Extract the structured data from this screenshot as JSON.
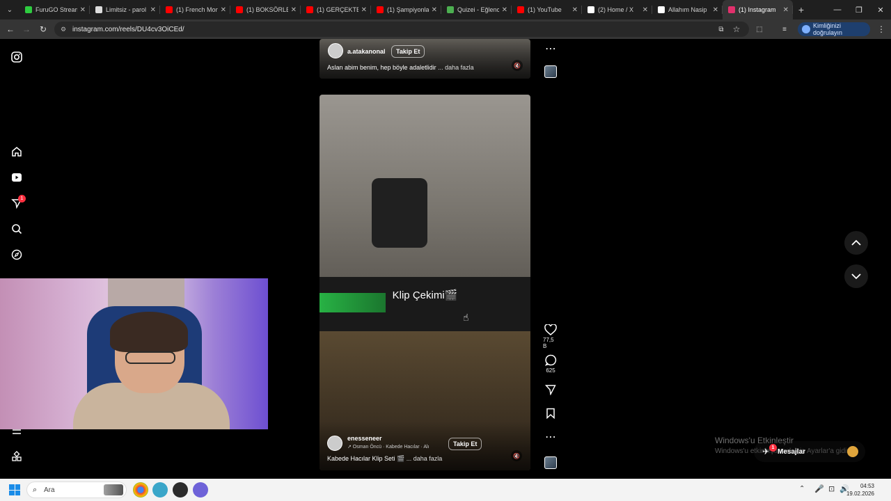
{
  "browser": {
    "tabs": [
      {
        "label": "FuruGO Stream",
        "color": "#2ecc40"
      },
      {
        "label": "Limitsiz - parol",
        "color": "#dddddd"
      },
      {
        "label": "(1) French Mon",
        "color": "#ff0000"
      },
      {
        "label": "(1) BOKSÖRLER",
        "color": "#ff0000"
      },
      {
        "label": "(1) GERÇEKTEN",
        "color": "#ff0000"
      },
      {
        "label": "(1) Şampiyonla",
        "color": "#ff0000"
      },
      {
        "label": "Quizei - Eğlenc",
        "color": "#4caf50"
      },
      {
        "label": "(1) YouTube",
        "color": "#ff0000"
      },
      {
        "label": "(2) Home / X",
        "color": "#ffffff"
      },
      {
        "label": "Allahım Nasip",
        "color": "#ffffff"
      },
      {
        "label": "(1) Instagram",
        "color": "#e1306c",
        "active": true
      }
    ],
    "url": "instagram.com/reels/DU4cv3OiCEd/",
    "identity_label": "Kimliğinizi doğrulayın"
  },
  "reels": {
    "top": {
      "username": "a.atakanonal",
      "follow": "Takip Et",
      "caption": "Aslan abim benim, hep böyle adaletlidir",
      "more": "... daha fazla"
    },
    "main": {
      "overlay_text": "Klip Çekimi🎬",
      "username": "enesseneer",
      "audio": "↗ Osman Öncü · Kabede Hacılar · Alı",
      "follow": "Takip Et",
      "caption": "Kabede Hacılar Klip Seti 🎬",
      "more": "... daha fazla"
    }
  },
  "actions": {
    "likes": "77,5 B",
    "comments": "625"
  },
  "notifications_badge": "1",
  "watermark": {
    "title": "Windows'u Etkinleştir",
    "subtitle": "Windows'u etkinleştirmek için Ayarlar'a gidin."
  },
  "messages": {
    "label": "Mesajlar",
    "badge": "1"
  },
  "taskbar": {
    "search_placeholder": "Ara",
    "time": "04:53",
    "date": "19.02.2026"
  }
}
